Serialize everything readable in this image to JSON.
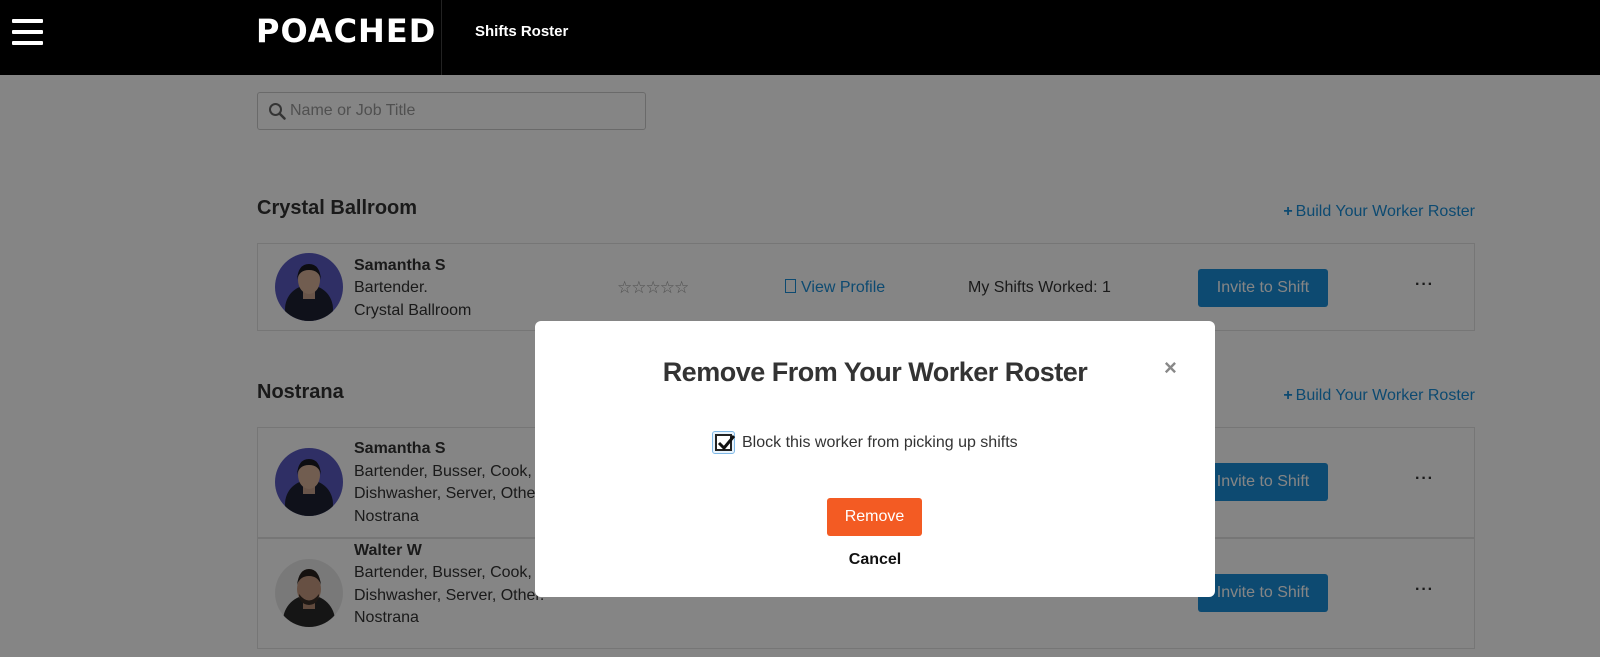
{
  "header": {
    "logo": "POACHED",
    "nav_tab": "Shifts Roster"
  },
  "search": {
    "placeholder": "Name or Job Title"
  },
  "groups": [
    {
      "title": "Crystal Ballroom",
      "build_link": "Build Your Worker Roster",
      "workers": [
        {
          "name": "Samantha S",
          "roles": [
            "Bartender."
          ],
          "venue": "Crystal Ballroom",
          "rating_stars": "☆☆☆☆☆",
          "view_profile": "View Profile",
          "shifts_worked": "My Shifts Worked: 1",
          "invite_label": "Invite to Shift",
          "more": "···"
        }
      ]
    },
    {
      "title": "Nostrana",
      "build_link": "Build Your Worker Roster",
      "workers": [
        {
          "name": "Samantha S",
          "roles": [
            "Bartender, Busser, Cook,",
            "Dishwasher, Server, Other."
          ],
          "venue": "Nostrana",
          "invite_label": "Invite to Shift",
          "more": "···"
        },
        {
          "name": "Walter W",
          "roles": [
            "Bartender, Busser, Cook,",
            "Dishwasher, Server, Other."
          ],
          "venue": "Nostrana",
          "invite_label": "Invite to Shift",
          "more": "···"
        }
      ]
    }
  ],
  "modal": {
    "title": "Remove From Your Worker Roster",
    "close": "×",
    "checkbox_label": "Block this worker from picking up shifts",
    "checkbox_checked": true,
    "remove_label": "Remove",
    "cancel_label": "Cancel"
  },
  "colors": {
    "accent": "#1a8fd8",
    "remove": "#f35b23",
    "header_bg": "#000000"
  },
  "icons": {
    "menu": "hamburger-icon",
    "search": "search-icon",
    "plus": "plus-icon",
    "document": "document-icon",
    "star": "star-outline-icon",
    "more": "ellipsis-icon",
    "close": "close-icon",
    "check": "check-icon"
  }
}
